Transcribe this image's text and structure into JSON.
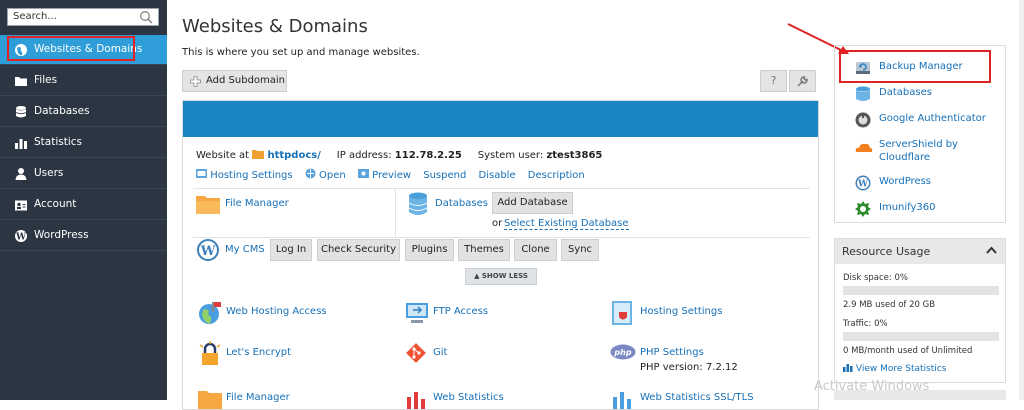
{
  "sidebar": {
    "search_placeholder": "Search...",
    "items": [
      {
        "label": "Websites & Domains",
        "icon": "globe-icon"
      },
      {
        "label": "Files",
        "icon": "folder-icon"
      },
      {
        "label": "Databases",
        "icon": "database-icon"
      },
      {
        "label": "Statistics",
        "icon": "bar-chart-icon"
      },
      {
        "label": "Users",
        "icon": "user-icon"
      },
      {
        "label": "Account",
        "icon": "id-card-icon"
      },
      {
        "label": "WordPress",
        "icon": "wordpress-icon"
      }
    ]
  },
  "header": {
    "title": "Websites & Domains",
    "description": "This is where you set up and manage websites."
  },
  "toolbar": {
    "add_subdomain": "Add Subdomain",
    "help": "?"
  },
  "site": {
    "website_at": "Website at",
    "docroot": "httpdocs/",
    "ip_label": "IP address:",
    "ip": "112.78.2.25",
    "user_label": "System user:",
    "user": "ztest3865",
    "actions": [
      "Hosting Settings",
      "Open",
      "Preview",
      "Suspend",
      "Disable",
      "Description"
    ]
  },
  "tools": {
    "file_manager": "File Manager",
    "databases": "Databases",
    "add_database": "Add Database",
    "or": "or",
    "select_db": "Select Existing Database",
    "my_cms": "My CMS",
    "cms_buttons": [
      "Log In",
      "Check Security",
      "Plugins",
      "Themes",
      "Clone",
      "Sync"
    ],
    "show_less": "SHOW LESS",
    "grid": [
      {
        "label": "Web Hosting Access",
        "icon": "web-access-icon"
      },
      {
        "label": "FTP Access",
        "icon": "ftp-icon"
      },
      {
        "label": "Hosting Settings",
        "icon": "hosting-settings-icon"
      },
      {
        "label": "Let's Encrypt",
        "icon": "lets-encrypt-icon"
      },
      {
        "label": "Git",
        "icon": "git-icon"
      },
      {
        "label": "PHP Settings",
        "icon": "php-icon",
        "sub": "PHP version: 7.2.12"
      },
      {
        "label": "File Manager",
        "icon": "folder-icon"
      },
      {
        "label": "Web Statistics",
        "icon": "stats-icon"
      },
      {
        "label": "Web Statistics SSL/TLS",
        "icon": "stats-icon"
      }
    ]
  },
  "right_panel": {
    "items": [
      {
        "label": "Backup Manager",
        "icon": "backup-icon"
      },
      {
        "label": "Databases",
        "icon": "database-icon"
      },
      {
        "label": "Google Authenticator",
        "icon": "authenticator-icon"
      },
      {
        "label": "ServerShield by",
        "label2": "Cloudflare",
        "icon": "cloudflare-icon"
      },
      {
        "label": "WordPress",
        "icon": "wordpress-icon"
      },
      {
        "label": "Imunify360",
        "icon": "imunify-icon"
      }
    ]
  },
  "resource_usage": {
    "title": "Resource Usage",
    "disk_label": "Disk space: 0%",
    "disk_fraction": 0.0,
    "disk_detail": "2.9 MB used of 20 GB",
    "traffic_label": "Traffic: 0%",
    "traffic_fraction": 0.0,
    "traffic_detail": "0 MB/month used of Unlimited",
    "view_more": "View More Statistics"
  },
  "watermark": "Activate Windows",
  "colors": {
    "sidebar_bg": "#2b3642",
    "active_nav": "#2f9ed8",
    "card_bar": "#1985c2",
    "link": "#1670b8",
    "highlight": "#e02222"
  }
}
